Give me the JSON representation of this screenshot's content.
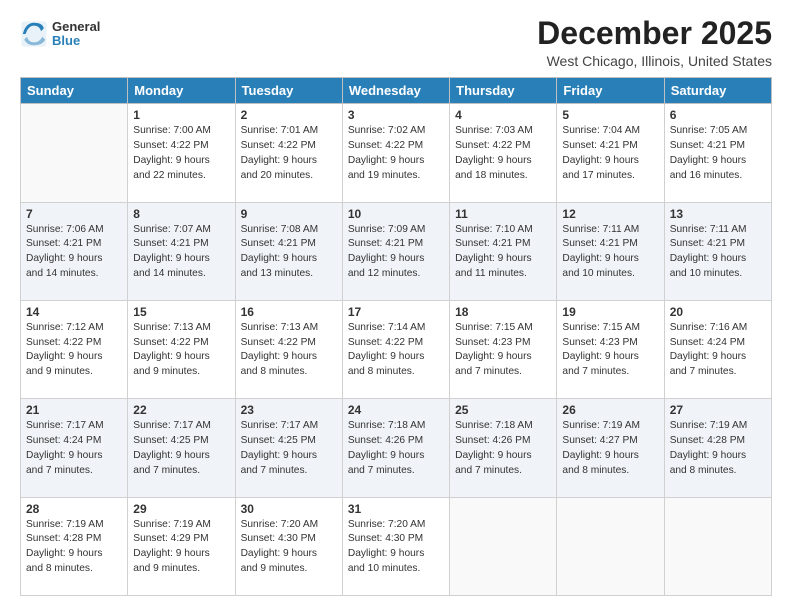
{
  "header": {
    "logo_general": "General",
    "logo_blue": "Blue",
    "month_title": "December 2025",
    "location": "West Chicago, Illinois, United States"
  },
  "days_of_week": [
    "Sunday",
    "Monday",
    "Tuesday",
    "Wednesday",
    "Thursday",
    "Friday",
    "Saturday"
  ],
  "weeks": [
    [
      {
        "day": "",
        "info": ""
      },
      {
        "day": "1",
        "info": "Sunrise: 7:00 AM\nSunset: 4:22 PM\nDaylight: 9 hours\nand 22 minutes."
      },
      {
        "day": "2",
        "info": "Sunrise: 7:01 AM\nSunset: 4:22 PM\nDaylight: 9 hours\nand 20 minutes."
      },
      {
        "day": "3",
        "info": "Sunrise: 7:02 AM\nSunset: 4:22 PM\nDaylight: 9 hours\nand 19 minutes."
      },
      {
        "day": "4",
        "info": "Sunrise: 7:03 AM\nSunset: 4:22 PM\nDaylight: 9 hours\nand 18 minutes."
      },
      {
        "day": "5",
        "info": "Sunrise: 7:04 AM\nSunset: 4:21 PM\nDaylight: 9 hours\nand 17 minutes."
      },
      {
        "day": "6",
        "info": "Sunrise: 7:05 AM\nSunset: 4:21 PM\nDaylight: 9 hours\nand 16 minutes."
      }
    ],
    [
      {
        "day": "7",
        "info": "Sunrise: 7:06 AM\nSunset: 4:21 PM\nDaylight: 9 hours\nand 14 minutes."
      },
      {
        "day": "8",
        "info": "Sunrise: 7:07 AM\nSunset: 4:21 PM\nDaylight: 9 hours\nand 14 minutes."
      },
      {
        "day": "9",
        "info": "Sunrise: 7:08 AM\nSunset: 4:21 PM\nDaylight: 9 hours\nand 13 minutes."
      },
      {
        "day": "10",
        "info": "Sunrise: 7:09 AM\nSunset: 4:21 PM\nDaylight: 9 hours\nand 12 minutes."
      },
      {
        "day": "11",
        "info": "Sunrise: 7:10 AM\nSunset: 4:21 PM\nDaylight: 9 hours\nand 11 minutes."
      },
      {
        "day": "12",
        "info": "Sunrise: 7:11 AM\nSunset: 4:21 PM\nDaylight: 9 hours\nand 10 minutes."
      },
      {
        "day": "13",
        "info": "Sunrise: 7:11 AM\nSunset: 4:21 PM\nDaylight: 9 hours\nand 10 minutes."
      }
    ],
    [
      {
        "day": "14",
        "info": "Sunrise: 7:12 AM\nSunset: 4:22 PM\nDaylight: 9 hours\nand 9 minutes."
      },
      {
        "day": "15",
        "info": "Sunrise: 7:13 AM\nSunset: 4:22 PM\nDaylight: 9 hours\nand 9 minutes."
      },
      {
        "day": "16",
        "info": "Sunrise: 7:13 AM\nSunset: 4:22 PM\nDaylight: 9 hours\nand 8 minutes."
      },
      {
        "day": "17",
        "info": "Sunrise: 7:14 AM\nSunset: 4:22 PM\nDaylight: 9 hours\nand 8 minutes."
      },
      {
        "day": "18",
        "info": "Sunrise: 7:15 AM\nSunset: 4:23 PM\nDaylight: 9 hours\nand 7 minutes."
      },
      {
        "day": "19",
        "info": "Sunrise: 7:15 AM\nSunset: 4:23 PM\nDaylight: 9 hours\nand 7 minutes."
      },
      {
        "day": "20",
        "info": "Sunrise: 7:16 AM\nSunset: 4:24 PM\nDaylight: 9 hours\nand 7 minutes."
      }
    ],
    [
      {
        "day": "21",
        "info": "Sunrise: 7:17 AM\nSunset: 4:24 PM\nDaylight: 9 hours\nand 7 minutes."
      },
      {
        "day": "22",
        "info": "Sunrise: 7:17 AM\nSunset: 4:25 PM\nDaylight: 9 hours\nand 7 minutes."
      },
      {
        "day": "23",
        "info": "Sunrise: 7:17 AM\nSunset: 4:25 PM\nDaylight: 9 hours\nand 7 minutes."
      },
      {
        "day": "24",
        "info": "Sunrise: 7:18 AM\nSunset: 4:26 PM\nDaylight: 9 hours\nand 7 minutes."
      },
      {
        "day": "25",
        "info": "Sunrise: 7:18 AM\nSunset: 4:26 PM\nDaylight: 9 hours\nand 7 minutes."
      },
      {
        "day": "26",
        "info": "Sunrise: 7:19 AM\nSunset: 4:27 PM\nDaylight: 9 hours\nand 8 minutes."
      },
      {
        "day": "27",
        "info": "Sunrise: 7:19 AM\nSunset: 4:28 PM\nDaylight: 9 hours\nand 8 minutes."
      }
    ],
    [
      {
        "day": "28",
        "info": "Sunrise: 7:19 AM\nSunset: 4:28 PM\nDaylight: 9 hours\nand 8 minutes."
      },
      {
        "day": "29",
        "info": "Sunrise: 7:19 AM\nSunset: 4:29 PM\nDaylight: 9 hours\nand 9 minutes."
      },
      {
        "day": "30",
        "info": "Sunrise: 7:20 AM\nSunset: 4:30 PM\nDaylight: 9 hours\nand 9 minutes."
      },
      {
        "day": "31",
        "info": "Sunrise: 7:20 AM\nSunset: 4:30 PM\nDaylight: 9 hours\nand 10 minutes."
      },
      {
        "day": "",
        "info": ""
      },
      {
        "day": "",
        "info": ""
      },
      {
        "day": "",
        "info": ""
      }
    ]
  ]
}
